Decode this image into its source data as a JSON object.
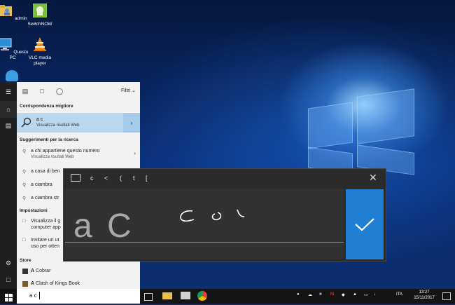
{
  "desktop_icons": [
    {
      "label": "admin",
      "icon": "user-folder-icon"
    },
    {
      "label": "SwitchNOW",
      "icon": "android-app-icon"
    },
    {
      "label": "Questo PC",
      "icon": "computer-icon"
    },
    {
      "label": "VLC media player",
      "icon": "vlc-cone-icon"
    }
  ],
  "search_panel": {
    "filter_label": "Filtri",
    "best_match_header": "Corrispondenza migliore",
    "best_match": {
      "title": "a c",
      "subtitle": "Visualizza risultati Web"
    },
    "suggestions_header": "Suggerimenti per la ricerca",
    "suggestions": [
      {
        "title": "a chi appartiene questo numero",
        "subtitle": "Visualizza risultati Web"
      },
      {
        "title": "a casa di ben"
      },
      {
        "title": "a ciambra"
      },
      {
        "title": "a ciambra str"
      }
    ],
    "settings_header": "Impostazioni",
    "settings": [
      {
        "line1": "Visualizza il g",
        "line2": "computer app"
      },
      {
        "line1": "Invitare un ut",
        "line2": "uso per otten"
      }
    ],
    "store_header": "Store",
    "store": [
      {
        "bold": "A",
        "rest": " Cobrar"
      },
      {
        "bold": "A",
        "rest": " Clash of Kings Book"
      }
    ]
  },
  "search_box": {
    "value": "a c"
  },
  "handwriting": {
    "candidates": [
      "c",
      "<",
      "(",
      "t",
      "["
    ],
    "recognized": "a C",
    "strokes_hint": "c o l"
  },
  "tray": {
    "language": "ITA",
    "time": "13:27",
    "date": "15/11/2017"
  },
  "colors": {
    "accent": "#1e7fd4",
    "best_match_bg": "#b9d8f0"
  }
}
